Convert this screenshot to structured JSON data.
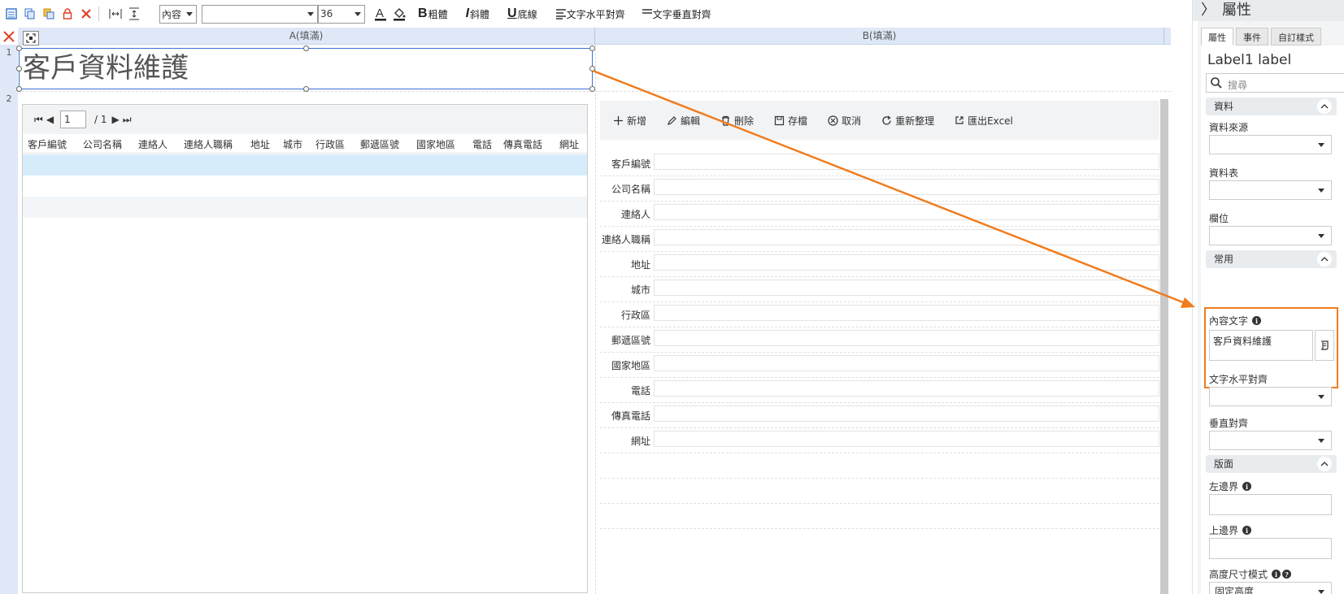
{
  "toolbar": {
    "content_select": "內容",
    "font_size": "36",
    "bold": "粗體",
    "italic": "斜體",
    "underline": "底線",
    "h_align": "文字水平對齊",
    "v_align": "文字垂直對齊"
  },
  "designer": {
    "col_a": "A(填滿)",
    "col_b": "B(填滿)",
    "row1": "1",
    "row2": "2",
    "title": "客戶資料維護"
  },
  "grid": {
    "page": "1",
    "total": "/ 1",
    "columns": [
      "客戶編號",
      "公司名稱",
      "連絡人",
      "連絡人職稱",
      "地址",
      "城市",
      "行政區",
      "郵遞區號",
      "國家地區",
      "電話",
      "傳真電話",
      "網址"
    ]
  },
  "form": {
    "buttons": [
      "新增",
      "編輯",
      "刪除",
      "存檔",
      "取消",
      "重新整理",
      "匯出Excel"
    ],
    "fields": [
      "客戶編號",
      "公司名稱",
      "連絡人",
      "連絡人職稱",
      "地址",
      "城市",
      "行政區",
      "郵遞區號",
      "國家地區",
      "電話",
      "傳真電話",
      "網址"
    ]
  },
  "panel": {
    "header": "屬性",
    "tabs": [
      "屬性",
      "事件",
      "自訂樣式"
    ],
    "object_title": "Label1 label",
    "search_placeholder": "搜尋",
    "section_data": "資料",
    "data_source": "資料來源",
    "data_table": "資料表",
    "field": "欄位",
    "section_common": "常用",
    "content_text_label": "內容文字",
    "content_text_value": "客戶資料維護",
    "h_align": "文字水平對齊",
    "v_align": "垂直對齊",
    "section_layout": "版面",
    "left_margin": "左邊界",
    "top_margin": "上邊界",
    "height_mode": "高度尺寸模式",
    "height_mode_value": "固定高度"
  },
  "colors": {
    "accent": "#f07c1e",
    "selection": "#3b73d6",
    "header_bg": "#dfe8f7"
  }
}
